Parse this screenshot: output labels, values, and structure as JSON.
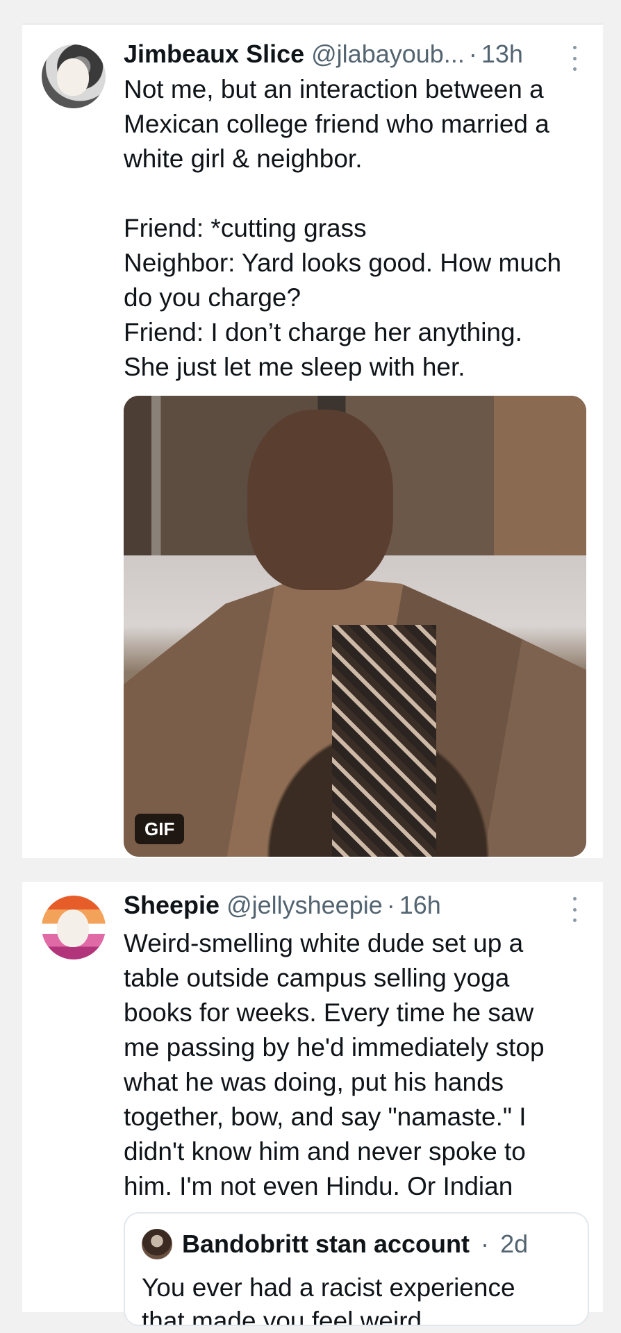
{
  "tweets": [
    {
      "author_name": "Jimbeaux Slice",
      "handle": "@jlabayoub...",
      "separator": "·",
      "time": "13h",
      "text": "Not me, but an interaction between a\nMexican college friend who married a\nwhite girl & neighbor.\n\nFriend: *cutting grass\nNeighbor: Yard looks good. How much\ndo you charge?\nFriend: I don’t charge her anything.\nShe just let me sleep with her.",
      "media_badge": "GIF"
    },
    {
      "author_name": "Sheepie",
      "handle": "@jellysheepie",
      "separator": "·",
      "time": "16h",
      "text": "Weird-smelling white dude set up a\ntable outside campus selling yoga\nbooks for weeks. Every time he saw\nme passing by he'd immediately stop\nwhat he was doing, put his hands\ntogether, bow, and say \"namaste.\" I\ndidn't know him and never spoke to\nhim. I'm not even Hindu. Or Indian",
      "quote": {
        "author_name": "Bandobritt stan account",
        "separator": "·",
        "time": "2d",
        "text": "You ever had a racist experience",
        "text_cutoff": "that made you feel weird"
      }
    }
  ],
  "icons": [
    "more-vertical-icon",
    "avatar-image"
  ],
  "colors": {
    "secondary_text": "#536471",
    "primary_text": "#0f1419",
    "background": "#f1f1f1"
  }
}
